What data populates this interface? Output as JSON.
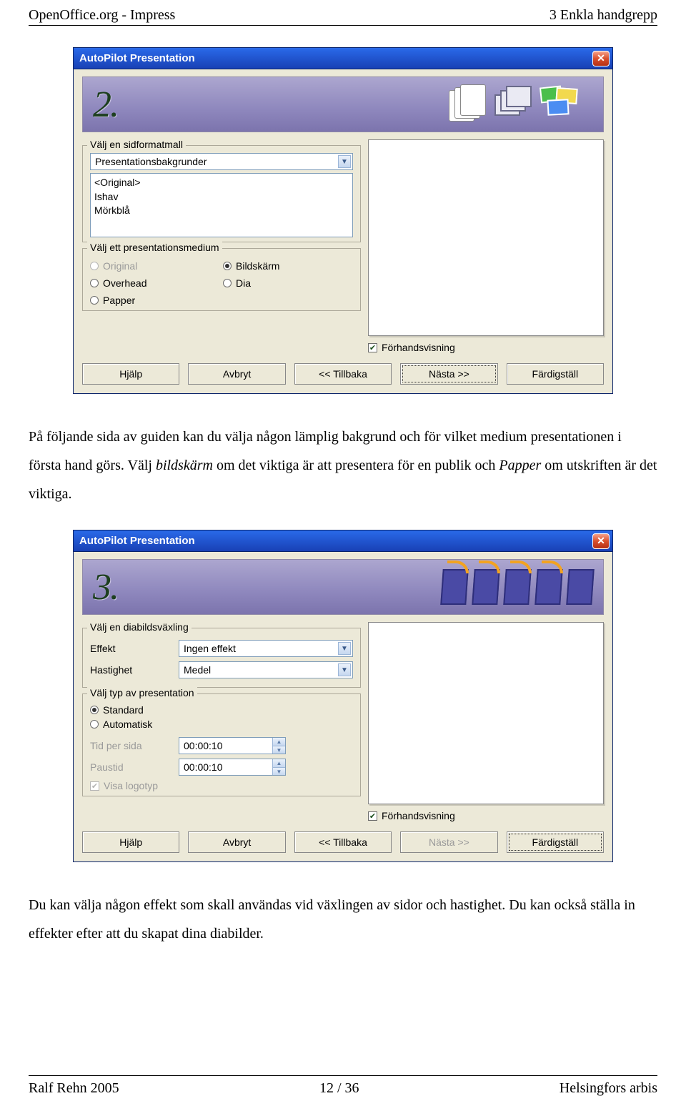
{
  "header": {
    "left": "OpenOffice.org - Impress",
    "right": "3 Enkla handgrepp"
  },
  "footer": {
    "left": "Ralf Rehn 2005",
    "center": "12 / 36",
    "right": "Helsingfors arbis"
  },
  "paragraph1": {
    "part1": "På följande sida av guiden kan du välja någon lämplig bakgrund och för vilket medium presentationen i första hand görs. Välj ",
    "em1": "bildskärm",
    "part2": " om det viktiga är att presentera för en publik och ",
    "em2": "Papper",
    "part3": " om utskriften är det viktiga."
  },
  "paragraph2": "Du kan välja någon effekt som skall användas vid växlingen av sidor och hastighet. Du kan också ställa in effekter efter att du skapat dina diabilder.",
  "buttons": {
    "help": "Hjälp",
    "cancel": "Avbryt",
    "back": "<< Tillbaka",
    "next": "Nästa >>",
    "finish": "Färdigställ"
  },
  "preview_label": "Förhandsvisning",
  "dialog2": {
    "title": "AutoPilot Presentation",
    "step": "2.",
    "group1_legend": "Välj en sidformatmall",
    "dropdown_value": "Presentationsbakgrunder",
    "list_items": [
      "<Original>",
      "Ishav",
      "Mörkblå"
    ],
    "group2_legend": "Välj ett presentationsmedium",
    "radios": {
      "original": "Original",
      "bildskarm": "Bildskärm",
      "overhead": "Overhead",
      "dia": "Dia",
      "papper": "Papper"
    }
  },
  "dialog3": {
    "title": "AutoPilot Presentation",
    "step": "3.",
    "group1_legend": "Välj en diabildsväxling",
    "effekt_label": "Effekt",
    "effekt_value": "Ingen effekt",
    "hastighet_label": "Hastighet",
    "hastighet_value": "Medel",
    "group2_legend": "Välj typ av presentation",
    "radios": {
      "standard": "Standard",
      "automatisk": "Automatisk"
    },
    "tid_label": "Tid per sida",
    "tid_value": "00:00:10",
    "paus_label": "Paustid",
    "paus_value": "00:00:10",
    "logo_label": "Visa logotyp"
  }
}
